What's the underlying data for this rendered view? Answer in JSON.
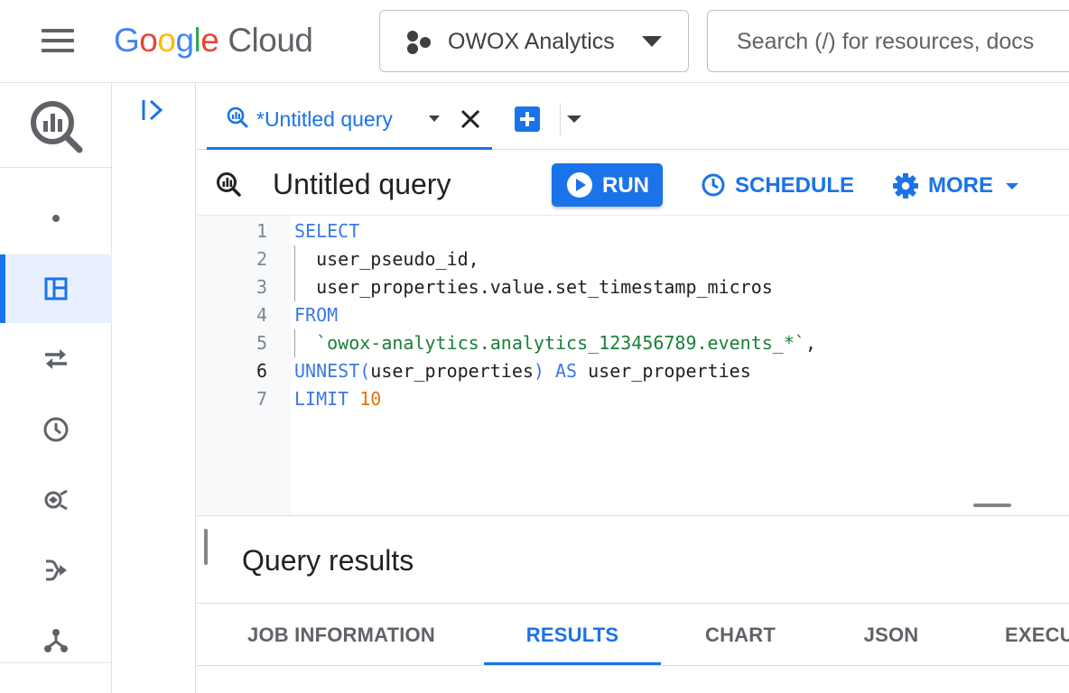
{
  "topbar": {
    "logo": {
      "g1": "G",
      "o1": "o",
      "o2": "o",
      "g2": "g",
      "l": "l",
      "e": "e",
      "cloud": "Cloud"
    },
    "project_name": "OWOX Analytics",
    "search_placeholder": "Search (/) for resources, docs"
  },
  "tabs": {
    "active_label": "*Untitled query"
  },
  "toolbar": {
    "title": "Untitled query",
    "run_label": "RUN",
    "schedule_label": "SCHEDULE",
    "more_label": "MORE"
  },
  "editor": {
    "line_numbers": [
      "1",
      "2",
      "3",
      "4",
      "5",
      "6",
      "7"
    ],
    "l1_kw": "SELECT",
    "l2": "  user_pseudo_id,",
    "l3": "  user_properties.value.set_timestamp_micros",
    "l4_kw": "FROM",
    "l5_str": "  `owox-analytics.analytics_123456789.events_*`",
    "l5_tail": ",",
    "l6_kw1": "UNNEST",
    "l6_p1": "(",
    "l6_mid": "user_properties",
    "l6_p2": ")",
    "l6_kw2": " AS ",
    "l6_tail": "user_properties",
    "l7_kw": "LIMIT",
    "l7_num": "10"
  },
  "results": {
    "title": "Query results",
    "tabs": [
      "JOB INFORMATION",
      "RESULTS",
      "CHART",
      "JSON",
      "EXECUTION DETAILS"
    ],
    "active_tab": "RESULTS"
  },
  "colors": {
    "accent": "#1a73e8",
    "keyword": "#3b78e7",
    "string": "#188038",
    "number": "#e8710a"
  },
  "icons": {
    "rail": [
      "bigquery-logo-icon",
      "dot-icon",
      "dashboard-icon",
      "transfer-icon",
      "clock-icon",
      "analytics-hub-icon",
      "pipeline-icon",
      "workflow-icon"
    ]
  }
}
